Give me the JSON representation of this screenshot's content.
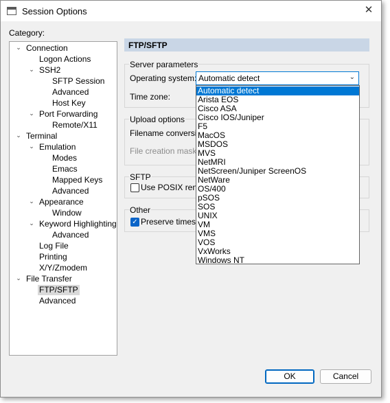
{
  "window": {
    "title": "Session Options",
    "close_glyph": "✕"
  },
  "category_label": "Category:",
  "tree": [
    {
      "label": "Connection",
      "expanded": true
    },
    {
      "label": "Logon Actions"
    },
    {
      "label": "SSH2",
      "expanded": true
    },
    {
      "label": "SFTP Session"
    },
    {
      "label": "Advanced"
    },
    {
      "label": "Host Key"
    },
    {
      "label": "Port Forwarding",
      "expanded": true
    },
    {
      "label": "Remote/X11"
    },
    {
      "label": "Terminal",
      "expanded": true
    },
    {
      "label": "Emulation",
      "expanded": true
    },
    {
      "label": "Modes"
    },
    {
      "label": "Emacs"
    },
    {
      "label": "Mapped Keys"
    },
    {
      "label": "Advanced"
    },
    {
      "label": "Appearance",
      "expanded": true
    },
    {
      "label": "Window"
    },
    {
      "label": "Keyword Highlighting",
      "expanded": true
    },
    {
      "label": "Advanced"
    },
    {
      "label": "Log File"
    },
    {
      "label": "Printing"
    },
    {
      "label": "X/Y/Zmodem"
    },
    {
      "label": "File Transfer",
      "expanded": true
    },
    {
      "label": "FTP/SFTP",
      "selected": true
    },
    {
      "label": "Advanced"
    }
  ],
  "panel_title": "FTP/SFTP",
  "server_params": {
    "title": "Server parameters",
    "os_label": "Operating system:",
    "os_value": "Automatic detect",
    "tz_label": "Time zone:"
  },
  "os_options": [
    "Automatic detect",
    "Arista EOS",
    "Cisco ASA",
    "Cisco IOS/Juniper",
    "F5",
    "MacOS",
    "MSDOS",
    "MVS",
    "NetMRI",
    "NetScreen/Juniper ScreenOS",
    "NetWare",
    "OS/400",
    "pSOS",
    "SOS",
    "UNIX",
    "VM",
    "VMS",
    "VOS",
    "VxWorks",
    "Windows NT"
  ],
  "upload": {
    "title": "Upload options",
    "filename_label": "Filename conversion",
    "creation_mask_label": "File creation mask:"
  },
  "sftp": {
    "title": "SFTP",
    "posix_label": "Use POSIX renar",
    "posix_checked": false
  },
  "other": {
    "title": "Other",
    "preserve_label": "Preserve timesta",
    "preserve_checked": true
  },
  "buttons": {
    "ok": "OK",
    "cancel": "Cancel"
  }
}
